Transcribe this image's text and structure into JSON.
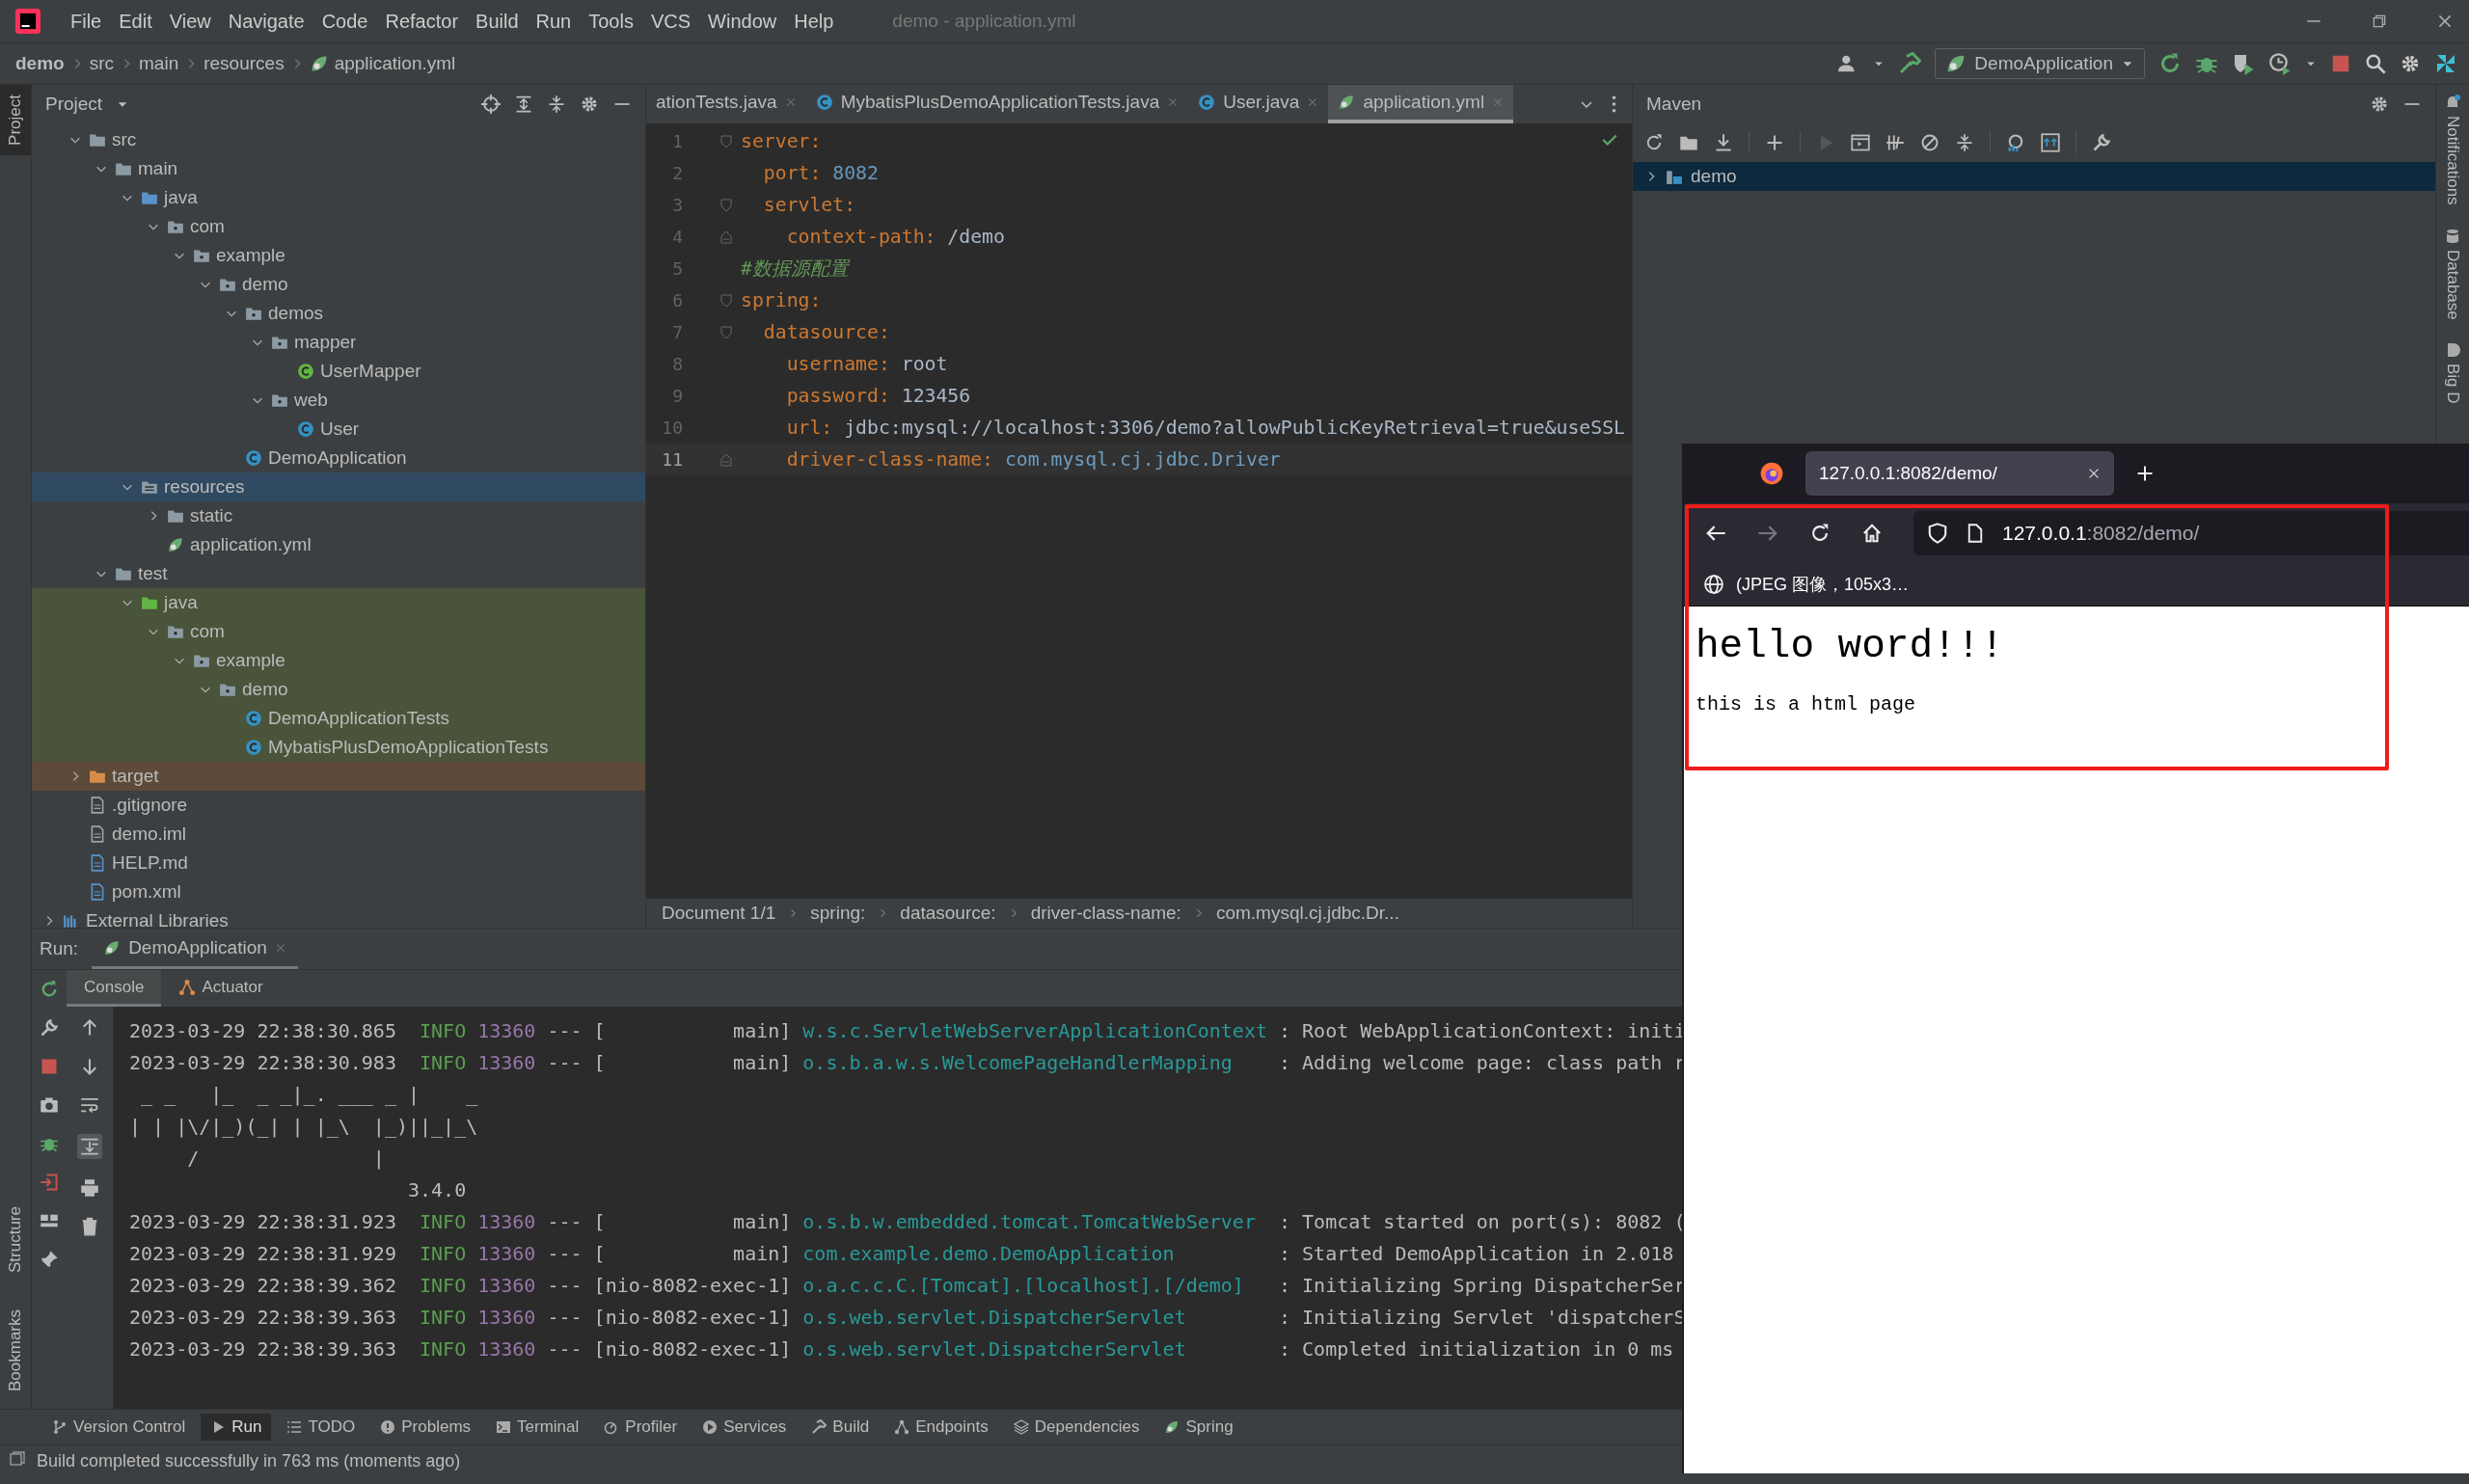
{
  "window": {
    "title": "demo - application.yml",
    "menu": [
      "File",
      "Edit",
      "View",
      "Navigate",
      "Code",
      "Refactor",
      "Build",
      "Run",
      "Tools",
      "VCS",
      "Window",
      "Help"
    ]
  },
  "breadcrumb": [
    "demo",
    "src",
    "main",
    "resources",
    "application.yml"
  ],
  "run_config": "DemoApplication",
  "left_top_tabs": [
    {
      "label": "Project",
      "selected": true
    }
  ],
  "left_bottom_tabs": [
    {
      "label": "Structure",
      "selected": false
    },
    {
      "label": "Bookmarks",
      "selected": false
    }
  ],
  "right_tabs": [
    "Notifications",
    "Database",
    "Big D"
  ],
  "project": {
    "title": "Project",
    "items": [
      {
        "label": "src",
        "kind": "folder",
        "expanded": true,
        "selected": false,
        "children": [
          {
            "label": "main",
            "kind": "folder",
            "expanded": true,
            "selected": false,
            "children": [
              {
                "label": "java",
                "kind": "source",
                "expanded": true,
                "selected": false,
                "children": [
                  {
                    "label": "com",
                    "kind": "package",
                    "expanded": true,
                    "selected": false,
                    "children": [
                      {
                        "label": "example",
                        "kind": "package",
                        "expanded": true,
                        "selected": false,
                        "children": [
                          {
                            "label": "demo",
                            "kind": "package",
                            "expanded": true,
                            "selected": false,
                            "children": [
                              {
                                "label": "demos",
                                "kind": "package",
                                "expanded": true,
                                "selected": false,
                                "children": [
                                  {
                                    "label": "mapper",
                                    "kind": "package",
                                    "expanded": true,
                                    "selected": false,
                                    "children": [
                                      {
                                        "label": "UserMapper",
                                        "kind": "interface",
                                        "selected": false
                                      }
                                    ]
                                  },
                                  {
                                    "label": "web",
                                    "kind": "package",
                                    "expanded": true,
                                    "selected": false,
                                    "children": [
                                      {
                                        "label": "User",
                                        "kind": "class",
                                        "selected": false
                                      }
                                    ]
                                  }
                                ]
                              },
                              {
                                "label": "DemoApplication",
                                "kind": "spring_class",
                                "selected": false
                              }
                            ]
                          }
                        ]
                      }
                    ]
                  }
                ]
              },
              {
                "label": "resources",
                "kind": "resources",
                "expanded": true,
                "selected": true,
                "children": [
                  {
                    "label": "static",
                    "kind": "folder",
                    "expanded": false,
                    "selected": false
                  },
                  {
                    "label": "application.yml",
                    "kind": "yml",
                    "selected": false
                  }
                ]
              }
            ]
          },
          {
            "label": "test",
            "kind": "folder",
            "expanded": true,
            "selected": false,
            "children": [
              {
                "label": "java",
                "kind": "test_source",
                "expanded": true,
                "selected": false,
                "test_scope": true,
                "children": [
                  {
                    "label": "com",
                    "kind": "package",
                    "expanded": true,
                    "selected": false,
                    "test_scope": true,
                    "children": [
                      {
                        "label": "example",
                        "kind": "package",
                        "expanded": true,
                        "selected": false,
                        "test_scope": true,
                        "children": [
                          {
                            "label": "demo",
                            "kind": "package",
                            "expanded": true,
                            "selected": false,
                            "test_scope": true,
                            "children": [
                              {
                                "label": "DemoApplicationTests",
                                "kind": "class",
                                "selected": false,
                                "test_scope": true
                              },
                              {
                                "label": "MybatisPlusDemoApplicationTests",
                                "kind": "class",
                                "selected": false,
                                "test_scope": true
                              }
                            ]
                          }
                        ]
                      }
                    ]
                  }
                ]
              }
            ]
          }
        ]
      },
      {
        "label": "target",
        "kind": "excluded",
        "expanded": false,
        "selected": false
      },
      {
        "label": ".gitignore",
        "kind": "file",
        "selected": false
      },
      {
        "label": "demo.iml",
        "kind": "file",
        "selected": false
      },
      {
        "label": "HELP.md",
        "kind": "doc",
        "selected": false
      },
      {
        "label": "pom.xml",
        "kind": "maven",
        "selected": false
      }
    ],
    "external": {
      "label": "External Libraries",
      "expanded": false
    }
  },
  "editor": {
    "tabs": [
      {
        "label": "ationTests.java",
        "kind": "none",
        "selected": false
      },
      {
        "label": "MybatisPlusDemoApplicationTests.java",
        "kind": "test_class",
        "selected": false
      },
      {
        "label": "User.java",
        "kind": "class",
        "selected": false
      },
      {
        "label": "application.yml",
        "kind": "yml",
        "selected": true
      }
    ],
    "lines": [
      {
        "line": "1",
        "key": "server:",
        "current": false,
        "children": [
          {
            "line": "2",
            "key": "port:",
            "value": "8082",
            "kind": "number",
            "current": false
          },
          {
            "line": "3",
            "key": "servlet:",
            "current": false,
            "children": [
              {
                "line": "4",
                "key": "context-path:",
                "value": "/demo",
                "kind": "plain",
                "current": false
              }
            ]
          }
        ]
      },
      {
        "line": "5",
        "comment": "#数据源配置",
        "current": false
      },
      {
        "line": "6",
        "key": "spring:",
        "current": false,
        "children": [
          {
            "line": "7",
            "key": "datasource:",
            "current": false,
            "children": [
              {
                "line": "8",
                "key": "username:",
                "value": "root",
                "kind": "plain",
                "current": false
              },
              {
                "line": "9",
                "key": "password:",
                "value": "123456",
                "kind": "plain",
                "current": false
              },
              {
                "line": "10",
                "key": "url:",
                "value": "jdbc:mysql://localhost:3306/demo?allowPublicKeyRetrieval=true&useSSL",
                "kind": "plain",
                "current": false
              },
              {
                "line": "11",
                "key": "driver-class-name:",
                "value": "com.mysql.cj.jdbc.Driver",
                "kind": "reference",
                "current": true
              }
            ]
          }
        ]
      }
    ],
    "breadcrumb": [
      "Document 1/1",
      "spring:",
      "datasource:",
      "driver-class-name:",
      "com.mysql.cj.jdbc.Dr..."
    ]
  },
  "maven": {
    "title": "Maven",
    "items": [
      {
        "label": "demo",
        "expanded": false,
        "selected": true
      }
    ]
  },
  "run": {
    "label": "Run:",
    "tabs": [
      {
        "label": "DemoApplication",
        "selected": true
      }
    ],
    "subtabs": [
      {
        "label": "Console",
        "selected": true
      },
      {
        "label": "Actuator",
        "selected": false
      }
    ],
    "lines": [
      {
        "kind": "log",
        "time": "2023-03-29 22:38:30.865",
        "level": "INFO",
        "pid": "13360",
        "thread": "--- [           main]",
        "logger": "w.s.c.ServletWebServerApplicationContext",
        "message": ": Root WebApplicationContext: initi"
      },
      {
        "kind": "log",
        "time": "2023-03-29 22:38:30.983",
        "level": "INFO",
        "pid": "13360",
        "thread": "--- [           main]",
        "logger": "o.s.b.a.w.s.WelcomePageHandlerMapping",
        "message": ": Adding welcome page: class path r"
      },
      {
        "kind": "text",
        "text": " _ _   |_  _ _|_. ___ _ |    _"
      },
      {
        "kind": "text",
        "text": "| | |\\/|_)(_| | |_\\  |_)||_|_\\"
      },
      {
        "kind": "text",
        "text": "     /               |"
      },
      {
        "kind": "text",
        "text": "                        3.4.0"
      },
      {
        "kind": "log",
        "time": "2023-03-29 22:38:31.923",
        "level": "INFO",
        "pid": "13360",
        "thread": "--- [           main]",
        "logger": "o.s.b.w.embedded.tomcat.TomcatWebServer",
        "message": ": Tomcat started on port(s): 8082 ("
      },
      {
        "kind": "log",
        "time": "2023-03-29 22:38:31.929",
        "level": "INFO",
        "pid": "13360",
        "thread": "--- [           main]",
        "logger": "com.example.demo.DemoApplication",
        "message": ": Started DemoApplication in 2.018"
      },
      {
        "kind": "log",
        "time": "2023-03-29 22:38:39.362",
        "level": "INFO",
        "pid": "13360",
        "thread": "--- [nio-8082-exec-1]",
        "logger": "o.a.c.c.C.[Tomcat].[localhost].[/demo]",
        "message": ": Initializing Spring DispatcherSer"
      },
      {
        "kind": "log",
        "time": "2023-03-29 22:38:39.363",
        "level": "INFO",
        "pid": "13360",
        "thread": "--- [nio-8082-exec-1]",
        "logger": "o.s.web.servlet.DispatcherServlet",
        "message": ": Initializing Servlet 'dispatcherS"
      },
      {
        "kind": "log",
        "time": "2023-03-29 22:38:39.363",
        "level": "INFO",
        "pid": "13360",
        "thread": "--- [nio-8082-exec-1]",
        "logger": "o.s.web.servlet.DispatcherServlet",
        "message": ": Completed initialization in 0 ms"
      }
    ]
  },
  "tool_windows": [
    {
      "label": "Version Control",
      "selected": false
    },
    {
      "label": "Run",
      "selected": true
    },
    {
      "label": "TODO",
      "selected": false
    },
    {
      "label": "Problems",
      "selected": false
    },
    {
      "label": "Terminal",
      "selected": false
    },
    {
      "label": "Profiler",
      "selected": false
    },
    {
      "label": "Services",
      "selected": false
    },
    {
      "label": "Build",
      "selected": false
    },
    {
      "label": "Endpoints",
      "selected": false
    },
    {
      "label": "Dependencies",
      "selected": false
    },
    {
      "label": "Spring",
      "selected": false
    }
  ],
  "status_bar": {
    "message": "Build completed successfully in 763 ms (moments ago)"
  },
  "browser": {
    "tab": "127.0.0.1:8082/demo/",
    "url": {
      "host": "127.0.0.1",
      "path": ":8082/demo/"
    },
    "forward_disabled": true,
    "bookmark": "(JPEG 图像，105x3…",
    "heading": "hello word!!!",
    "text": "this is a html page"
  }
}
